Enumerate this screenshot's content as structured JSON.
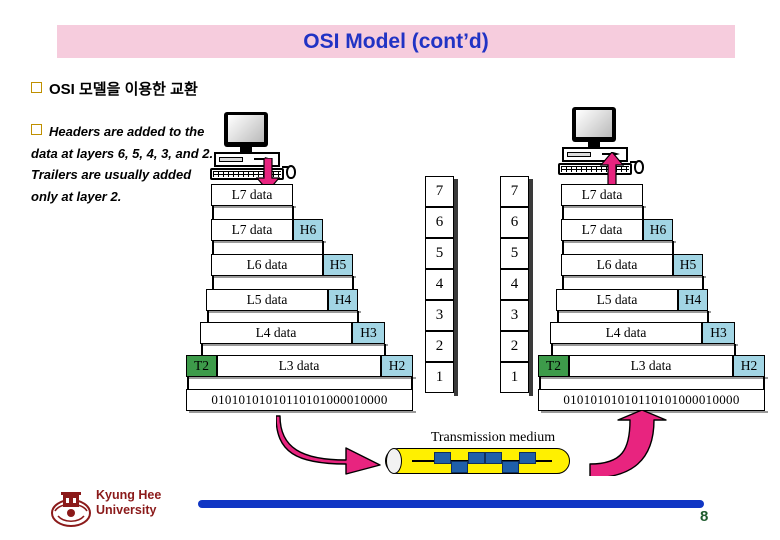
{
  "slide": {
    "title": "OSI Model (cont’d)",
    "page_number": "8",
    "accent_colors": {
      "title_band": "#f6ccdd",
      "title_text": "#2133c4",
      "header_box": "#a2d5e4",
      "trailer_box": "#3d9b4a",
      "arrow_pink": "#e8247f",
      "cable_yellow": "#fff000",
      "signal_blue": "#1f5fa9",
      "footer_rule": "#1036c4",
      "university_text": "#8b1a1a",
      "page_number": "#1f5c2e",
      "bullet_square": "#bf9000"
    }
  },
  "bullets": [
    {
      "text": "OSI 모델을 이용한 교환"
    },
    {
      "text": "Headers are added to the data at layers 6, 5, 4, 3, and 2. Trailers are usually added only at layer 2."
    }
  ],
  "layer_numbers": [
    "7",
    "6",
    "5",
    "4",
    "3",
    "2",
    "1"
  ],
  "pdu_stack": {
    "rows": [
      {
        "data_label": "L7 data",
        "header": null,
        "trailer": null
      },
      {
        "data_label": "L7 data",
        "header": "H6",
        "trailer": null
      },
      {
        "data_label": "L6 data",
        "header": "H5",
        "trailer": null
      },
      {
        "data_label": "L5 data",
        "header": "H4",
        "trailer": null
      },
      {
        "data_label": "L4 data",
        "header": "H3",
        "trailer": null
      },
      {
        "data_label": "L3 data",
        "header": "H2",
        "trailer": "T2"
      }
    ],
    "bitstream": "01010101010110101000010000"
  },
  "medium": {
    "label": "Transmission medium"
  },
  "footer": {
    "university_line1": "Kyung Hee",
    "university_line2": "University"
  },
  "icons": {
    "sender_computer": "desktop-computer-icon",
    "receiver_computer": "desktop-computer-icon",
    "down_arrow": "arrow-down-icon",
    "up_arrow": "arrow-up-icon",
    "curve_arrow_right": "curved-arrow-right-icon",
    "curve_arrow_up": "curved-arrow-up-icon",
    "logo": "kyung-hee-university-crest-icon"
  }
}
